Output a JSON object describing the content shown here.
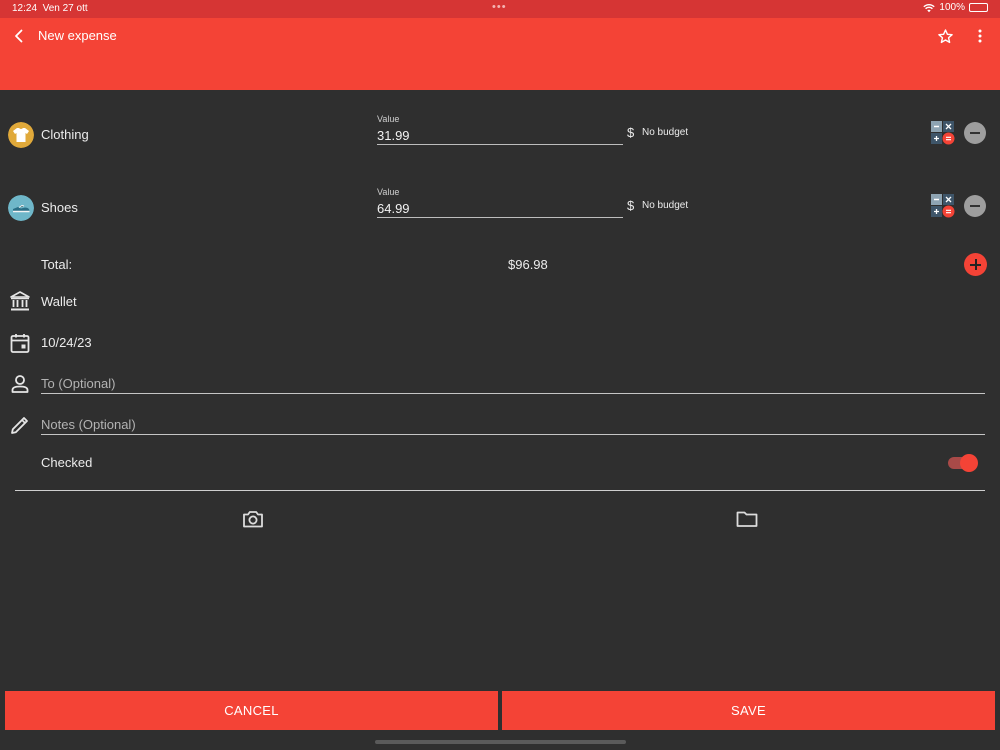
{
  "status_bar": {
    "time": "12:24",
    "date": "Ven 27 ott",
    "battery": "100%"
  },
  "app_bar": {
    "title": "New expense"
  },
  "categories": [
    {
      "name": "Clothing",
      "value_label": "Value",
      "value": "31.99",
      "currency": "$",
      "budget": "No budget",
      "icon": "tshirt-icon"
    },
    {
      "name": "Shoes",
      "value_label": "Value",
      "value": "64.99",
      "currency": "$",
      "budget": "No budget",
      "icon": "shoe-icon"
    }
  ],
  "total": {
    "label": "Total:",
    "value": "$96.98"
  },
  "account": {
    "name": "Wallet",
    "icon": "bank-icon"
  },
  "date": {
    "value": "10/24/23",
    "icon": "calendar-icon"
  },
  "to": {
    "placeholder": "To (Optional)",
    "value": ""
  },
  "notes": {
    "placeholder": "Notes (Optional)",
    "value": ""
  },
  "checked": {
    "label": "Checked",
    "on": true
  },
  "attachments": {
    "camera": "camera-icon",
    "folder": "folder-icon"
  },
  "actions": {
    "cancel": "CANCEL",
    "save": "SAVE"
  },
  "colors": {
    "primary": "#f44336",
    "status_bar": "#d63534",
    "background": "#2f2f2f"
  }
}
